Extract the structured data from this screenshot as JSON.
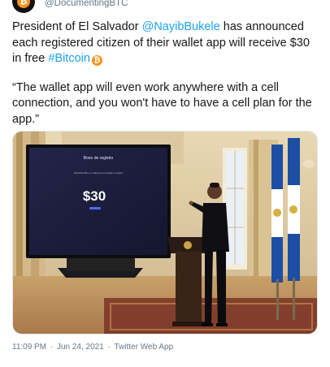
{
  "tweet": {
    "handle": "@DocumentingBTC",
    "text_before_mention": "President of El Salvador ",
    "mention": "@NayibBukele",
    "text_after_mention": " has announced each registered citizen of their wallet app will receive $30 in free ",
    "hashtag": "#Bitcoin",
    "quote": "“The wallet app will even work anywhere with a cell connection, and you won't have to have a cell plan for the app.”",
    "time": "11:09 PM",
    "separator": "·",
    "date": "Jun 24, 2021",
    "source": "Twitter Web App"
  },
  "photo": {
    "screen_heading": "Bono de registro",
    "screen_subtext": "Obtendrás $30 en tu billetera al completar tu registro",
    "screen_amount": "$30"
  },
  "icons": {
    "avatar": "bitcoin-logo-icon",
    "coin": "bitcoin-emoji-icon"
  },
  "colors": {
    "link": "#1da1f2",
    "bitcoin": "#f7931a",
    "secondary_text": "#657786"
  }
}
